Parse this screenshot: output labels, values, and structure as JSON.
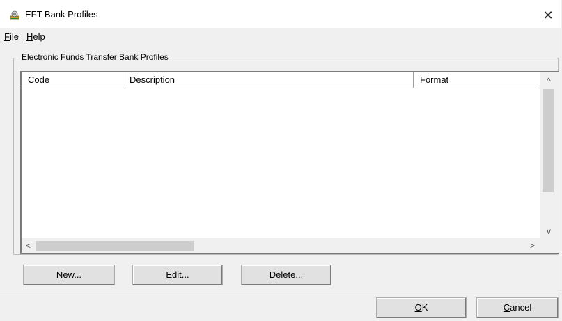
{
  "window": {
    "title": "EFT Bank Profiles",
    "close_glyph": "✕"
  },
  "menu": {
    "file": {
      "mnemonic": "F",
      "rest": "ile"
    },
    "help": {
      "mnemonic": "H",
      "rest": "elp"
    }
  },
  "group": {
    "label": "Electronic Funds Transfer Bank Profiles"
  },
  "list": {
    "columns": [
      "Code",
      "Description",
      "Format"
    ],
    "rows": []
  },
  "buttons": {
    "new": {
      "mnemonic": "N",
      "rest": "ew..."
    },
    "edit": {
      "mnemonic": "E",
      "rest": "dit..."
    },
    "delete": {
      "mnemonic": "D",
      "rest": "elete..."
    },
    "ok": {
      "mnemonic": "O",
      "rest": "K"
    },
    "cancel": {
      "mnemonic": "C",
      "rest": "ancel"
    }
  },
  "icons": {
    "app": "bank-profile-icon",
    "scroll_up": "^",
    "scroll_down": "v",
    "scroll_left": "<",
    "scroll_right": ">"
  }
}
